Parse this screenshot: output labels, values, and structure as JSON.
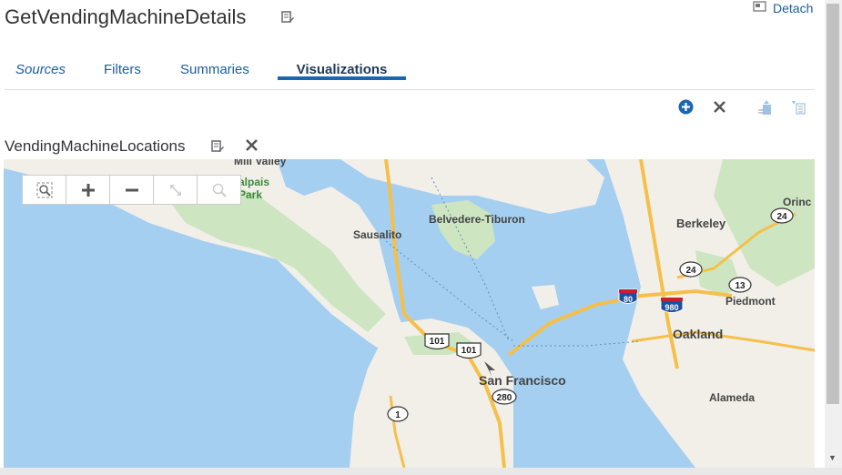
{
  "header": {
    "title": "GetVendingMachineDetails",
    "detach_label": "Detach"
  },
  "tabs": [
    {
      "label": "Sources"
    },
    {
      "label": "Filters"
    },
    {
      "label": "Summaries"
    },
    {
      "label": "Visualizations",
      "active": true
    }
  ],
  "visualization": {
    "title": "VendingMachineLocations"
  },
  "map": {
    "labels": {
      "mill_valley": "Mill Valley",
      "alpais": "alpais",
      "park": "Park",
      "belvedere": "Belvedere-Tiburon",
      "sausalito": "Sausalito",
      "berkeley": "Berkeley",
      "orinda": "Orinc",
      "piedmont": "Piedmont",
      "oakland": "Oakland",
      "san_francisco": "San Francisco",
      "alameda": "Alameda"
    },
    "shields": {
      "r24a": "24",
      "r24b": "24",
      "r13": "13",
      "i80": "80",
      "i980": "980",
      "us101a": "101",
      "us101b": "101",
      "i280": "280",
      "r1": "1"
    }
  },
  "colors": {
    "water": "#a5cff0",
    "land": "#f2efe9",
    "park": "#cde6c1",
    "highway": "#f5c04a",
    "accent": "#1a66b0",
    "link": "#1a5d9e"
  }
}
